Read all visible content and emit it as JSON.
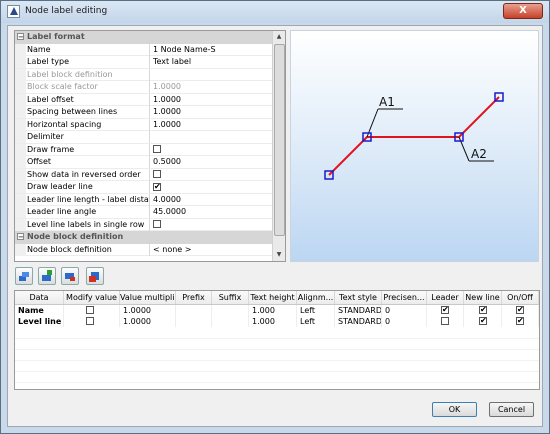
{
  "window": {
    "title": "Node label editing",
    "close_label": "X"
  },
  "propgrid": {
    "categories": [
      {
        "label": "Label format",
        "expander": "−"
      },
      {
        "label": "Node block definition",
        "expander": "−"
      }
    ],
    "rows": [
      {
        "name": "Name",
        "value": "1 Node Name-S"
      },
      {
        "name": "Label type",
        "value": "Text label"
      },
      {
        "name": "Label block definition",
        "value": ""
      },
      {
        "name": "Block scale factor",
        "value": "1.0000"
      },
      {
        "name": "Label offset",
        "value": "1.0000"
      },
      {
        "name": "Spacing between lines",
        "value": "1.0000"
      },
      {
        "name": "Horizontal spacing",
        "value": "1.0000"
      },
      {
        "name": "Delimiter",
        "value": ""
      },
      {
        "name": "Draw frame",
        "value": ""
      },
      {
        "name": "Offset",
        "value": "0.5000"
      },
      {
        "name": "Show data in reversed order",
        "value": ""
      },
      {
        "name": "Draw leader line",
        "value": ""
      },
      {
        "name": "Leader line length - label distance",
        "value": "4.0000"
      },
      {
        "name": "Leader line angle",
        "value": "45.0000"
      },
      {
        "name": "Level line labels in single row",
        "value": ""
      }
    ],
    "node_block_row": {
      "name": "Node block definition",
      "value": "< none >"
    }
  },
  "preview": {
    "labels": [
      "A1",
      "A2"
    ],
    "line_color": "#e0141e",
    "node_color": "#1a1acc"
  },
  "toolbar": [
    "move-up-icon",
    "add-row-icon",
    "remove-row-icon",
    "delete-icon"
  ],
  "table": {
    "columns": [
      "Data",
      "Modify value",
      "Value multipli...",
      "Prefix",
      "Suffix",
      "Text height",
      "Alignm...",
      "Text style",
      "Precisen...",
      "Leader",
      "New line",
      "On/Off"
    ],
    "rows": [
      {
        "data": "Name",
        "multiplier": "1.0000",
        "prefix": "",
        "suffix": "",
        "text_height": "1.000",
        "alignment": "Left",
        "text_style": "STANDARD",
        "precision": "0"
      },
      {
        "data": "Level line el",
        "multiplier": "1.0000",
        "prefix": "",
        "suffix": "",
        "text_height": "1.000",
        "alignment": "Left",
        "text_style": "STANDARD",
        "precision": "0"
      }
    ]
  },
  "buttons": {
    "ok": "OK",
    "cancel": "Cancel"
  }
}
